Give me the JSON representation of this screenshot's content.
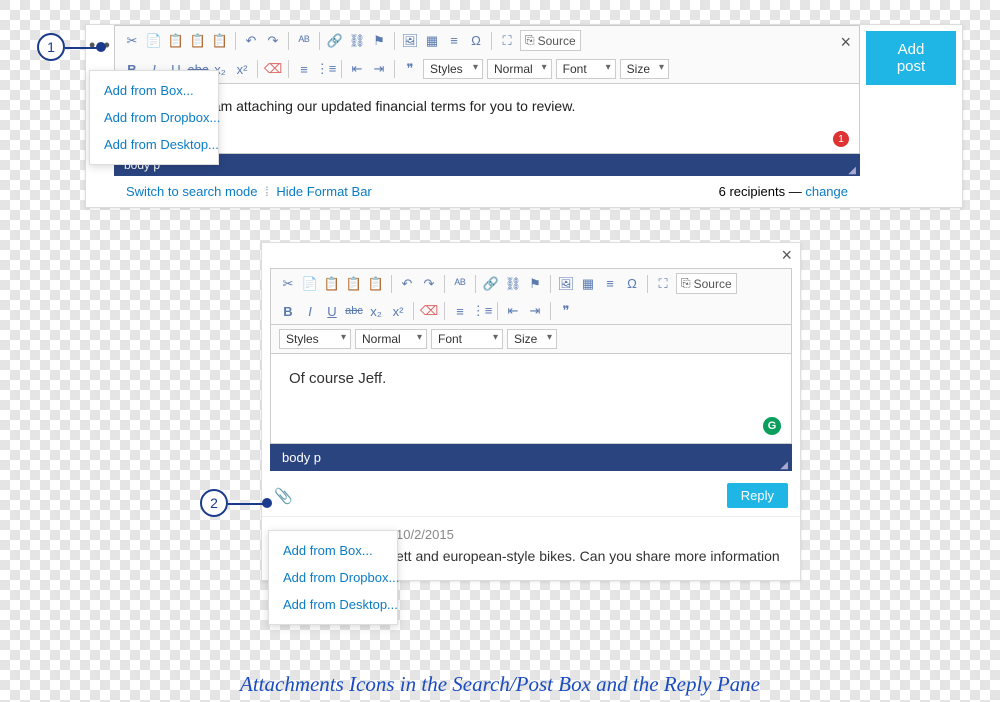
{
  "badges": {
    "one": "1",
    "two": "2"
  },
  "panel1": {
    "menu_trigger": "•••",
    "close": "×",
    "source_label": "Source",
    "dropdowns": {
      "styles": "Styles",
      "normal": "Normal",
      "font": "Font",
      "size": "Size"
    },
    "content": "I am attaching our updated financial terms for you to review.",
    "notif_count": "1",
    "status": "body   p",
    "footer": {
      "switch": "Switch to search mode",
      "hide": "Hide Format Bar",
      "recipients": "6 recipients — ",
      "change": "change"
    },
    "add_post": "Add post"
  },
  "attach_menu": {
    "box": "Add from Box...",
    "dropbox": "Add from Dropbox...",
    "desktop": "Add from Desktop..."
  },
  "panel2": {
    "close": "×",
    "source_label": "Source",
    "dropdowns": {
      "styles": "Styles",
      "normal": "Normal",
      "font": "Font",
      "size": "Size"
    },
    "bold": "B",
    "italic": "I",
    "underline": "U",
    "strike": "abc",
    "sub": "x₂",
    "sup": "x²",
    "content": "Of course Jeff.",
    "badge_g": "G",
    "status": "body   p",
    "reply": "Reply",
    "previous": {
      "date": "10/2/2015",
      "body": "ett and european-style bikes. Can you share more information"
    }
  },
  "caption": "Attachments Icons in the Search/Post Box and the Reply Pane"
}
